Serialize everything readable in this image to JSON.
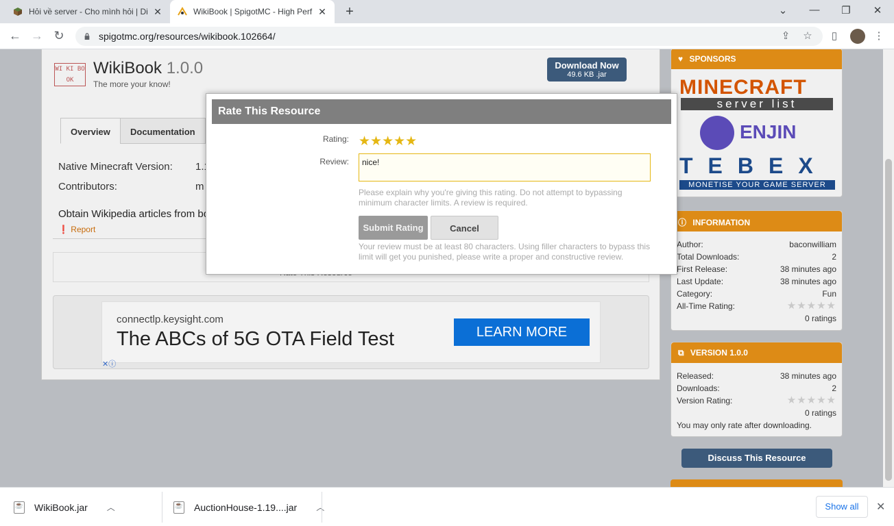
{
  "browser": {
    "tabs": [
      {
        "title": "Hỏi về server - Cho mình hỏi | Di",
        "close": "✕"
      },
      {
        "title": "WikiBook | SpigotMC - High Perf",
        "close": "✕"
      }
    ],
    "new_tab": "+",
    "url": "spigotmc.org/resources/wikibook.102664/",
    "window_controls": {
      "minimize": "—",
      "maximize": "❐",
      "close": "✕",
      "tab_search": "⌄"
    },
    "nav": {
      "back": "←",
      "forward": "→",
      "reload": "↻"
    },
    "toolbar_icons": {
      "share": "⇪",
      "bookmark": "☆",
      "sidepanel": "▯",
      "menu": "⋮"
    }
  },
  "resource": {
    "icon_text": "WI KI BO OK",
    "name": "WikiBook",
    "version": "1.0.0",
    "tagline": "The more your know!",
    "download": {
      "label": "Download Now",
      "sub": "49.6 KB .jar"
    },
    "tabs": [
      "Overview",
      "Documentation"
    ],
    "info": [
      {
        "label": "Native Minecraft Version:",
        "value": "1.1"
      },
      {
        "label": "Contributors:",
        "value": "m"
      }
    ],
    "description": "Obtain Wikipedia articles from bo",
    "report": "Report",
    "rate_link": "Rate This Resource"
  },
  "ad": {
    "domain": "connectlp.keysight.com",
    "headline": "The ABCs of 5G OTA Field Test",
    "button": "LEARN MORE",
    "choices": "✕ⓘ"
  },
  "sidebar": {
    "sponsors": {
      "title": "SPONSORS",
      "logos": [
        "MINECRAFT",
        "server list",
        "ENJIN",
        "TEBEX",
        "MONETISE YOUR GAME SERVER"
      ]
    },
    "information": {
      "title": "INFORMATION",
      "rows": [
        {
          "label": "Author:",
          "value": "baconwilliam"
        },
        {
          "label": "Total Downloads:",
          "value": "2"
        },
        {
          "label": "First Release:",
          "value": "38 minutes ago"
        },
        {
          "label": "Last Update:",
          "value": "38 minutes ago"
        },
        {
          "label": "Category:",
          "value": "Fun"
        },
        {
          "label": "All-Time Rating:",
          "value": "★★★★★"
        }
      ],
      "ratings": "0 ratings"
    },
    "version": {
      "title": "VERSION 1.0.0",
      "rows": [
        {
          "label": "Released:",
          "value": "38 minutes ago"
        },
        {
          "label": "Downloads:",
          "value": "2"
        },
        {
          "label": "Version Rating:",
          "value": "★★★★★"
        }
      ],
      "ratings": "0 ratings",
      "note": "You may only rate after downloading."
    },
    "discuss": "Discuss This Resource"
  },
  "modal": {
    "title": "Rate This Resource",
    "rating_label": "Rating:",
    "stars": "★★★★★",
    "rating_value": 5,
    "review_label": "Review:",
    "review_value": "nice!",
    "hint": "Please explain why you're giving this rating. Do not attempt to bypassing minimum character limits. A review is required.",
    "submit": "Submit Rating",
    "cancel": "Cancel",
    "warning": "Your review must be at least 80 characters. Using filler characters to bypass this limit will get you punished, please write a proper and constructive review."
  },
  "downloads": {
    "items": [
      {
        "name": "WikiBook.jar"
      },
      {
        "name": "AuctionHouse-1.19....jar"
      }
    ],
    "show_all": "Show all",
    "close": "✕"
  },
  "colors": {
    "accent_orange": "#dd8b16",
    "button_blue": "#3c5a7b",
    "star_gold": "#e5b713",
    "ad_blue": "#0b6fd6"
  }
}
